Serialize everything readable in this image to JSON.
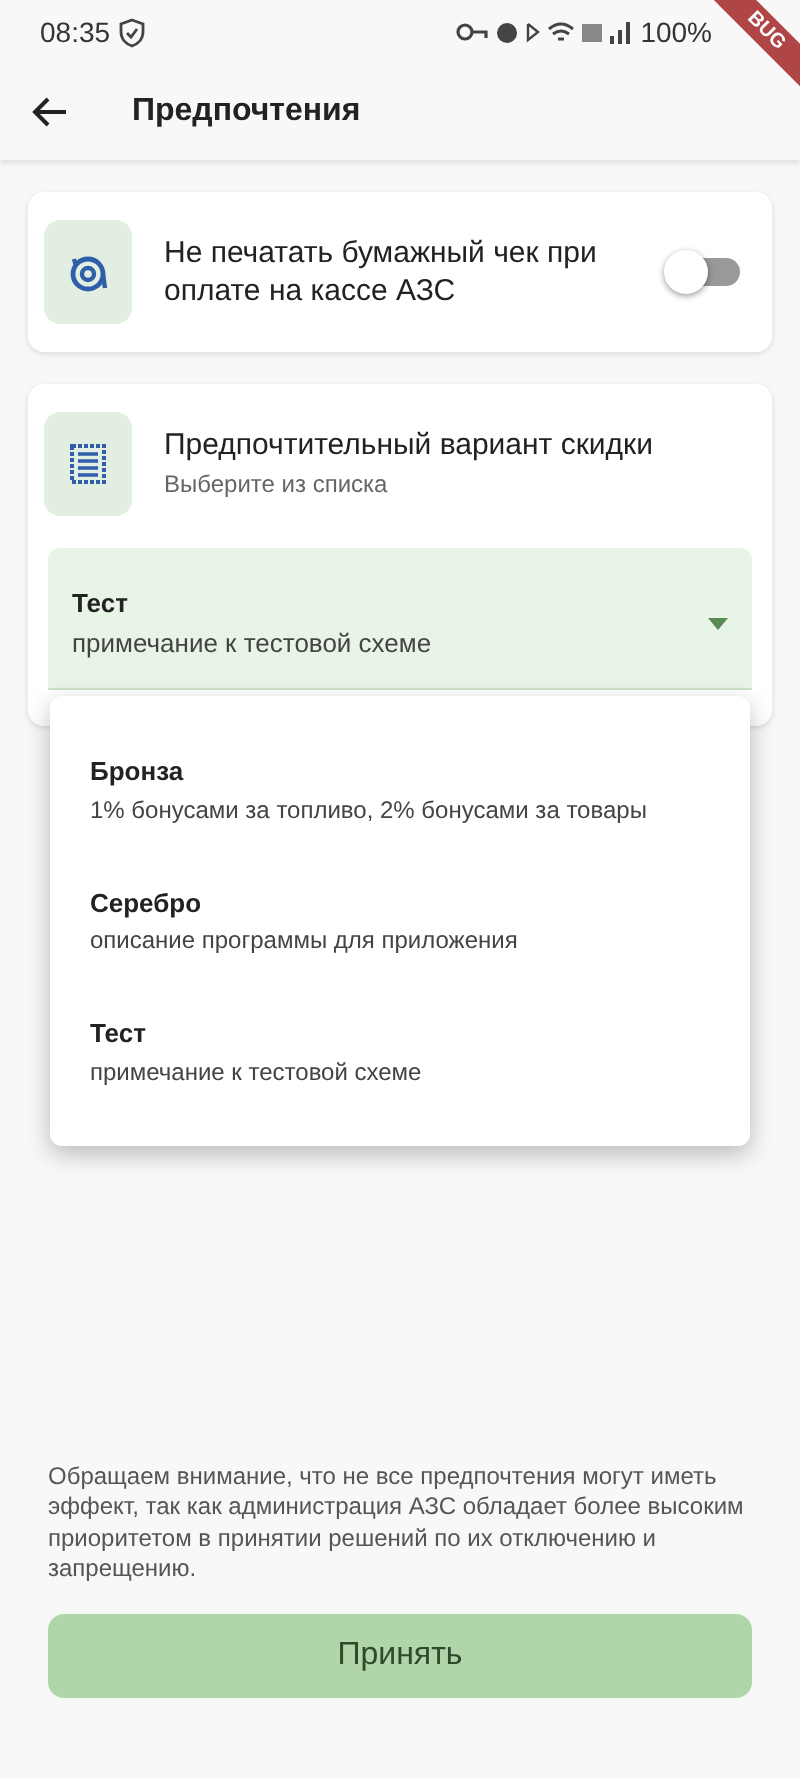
{
  "status_bar": {
    "time": "08:35",
    "battery": "100%"
  },
  "debug_banner": {
    "text": "BUG"
  },
  "app_bar": {
    "title": "Предпочтения"
  },
  "settings": [
    {
      "kind": "toggle",
      "title": "Не печатать бумажный чек при оплате на кассе АЗС",
      "on": false
    },
    {
      "kind": "select",
      "title": "Предпочтительный вариант скидки",
      "subtitle": "Выберите из списка",
      "value": {
        "title": "Тест",
        "note": "примечание к тестовой схеме"
      },
      "expanded": true,
      "options": [
        {
          "title": "Бронза",
          "note": "1% бонусами за топливо, 2% бонусами за товары"
        },
        {
          "title": "Серебро",
          "note": "описание программы для приложения"
        },
        {
          "title": "Тест",
          "note": "примечание к тестовой схеме"
        }
      ]
    }
  ],
  "notice": "Обращаем внимание, что не все предпочтения могут иметь эффект, так как администрация АЗС обладает более высоким приоритетом в принятии решений по их отключению и запрещению.",
  "accept_button": {
    "label": "Принять"
  }
}
